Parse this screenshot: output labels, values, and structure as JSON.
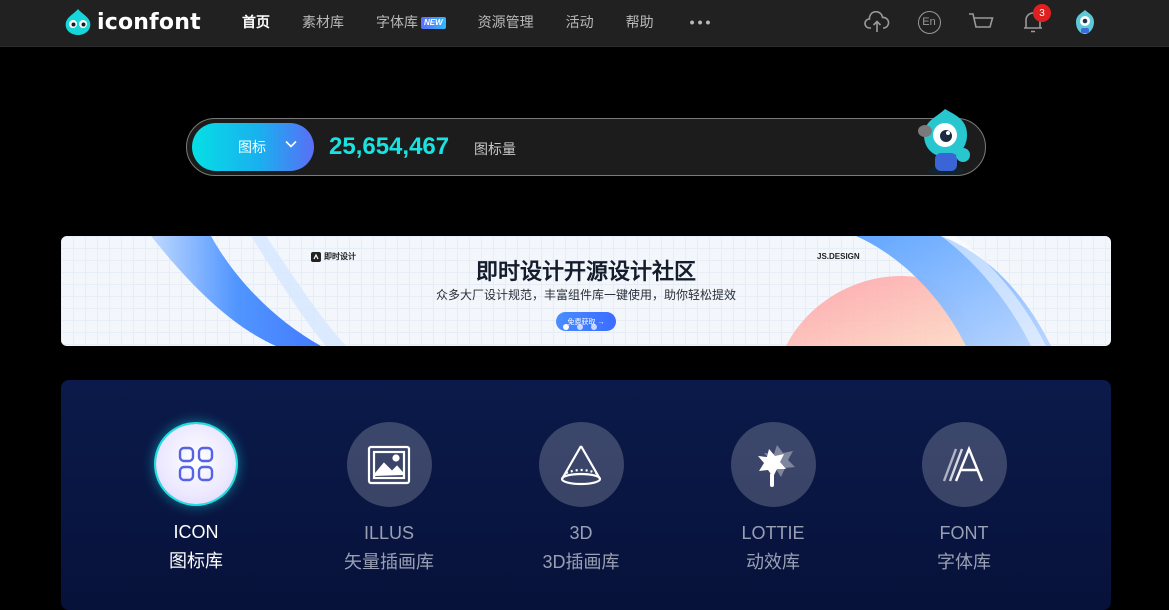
{
  "header": {
    "logo_text": "iconfont",
    "nav": [
      {
        "label": "首页",
        "active": true
      },
      {
        "label": "素材库",
        "active": false
      },
      {
        "label": "字体库",
        "active": false,
        "badge": "NEW"
      },
      {
        "label": "资源管理",
        "active": false
      },
      {
        "label": "活动",
        "active": false
      },
      {
        "label": "帮助",
        "active": false
      }
    ],
    "more": "•••",
    "lang_label": "En",
    "notification_count": "3"
  },
  "search": {
    "type_label": "图标",
    "count": "25,654,467",
    "count_label": "图标量"
  },
  "banner": {
    "brand_left": "即时设计",
    "brand_right": "JS.DESIGN",
    "title": "即时设计开源设计社区",
    "subtitle": "众多大厂设计规范，丰富组件库一键使用，助你轻松提效",
    "button": "免费获取 →"
  },
  "categories": [
    {
      "en": "ICON",
      "cn": "图标库",
      "icon": "icon-grid-icon",
      "active": true
    },
    {
      "en": "ILLUS",
      "cn": "矢量插画库",
      "icon": "image-icon",
      "active": false
    },
    {
      "en": "3D",
      "cn": "3D插画库",
      "icon": "cone-3d-icon",
      "active": false
    },
    {
      "en": "LOTTIE",
      "cn": "动效库",
      "icon": "lottie-icon",
      "active": false
    },
    {
      "en": "FONT",
      "cn": "字体库",
      "icon": "font-a-icon",
      "active": false
    }
  ],
  "colors": {
    "accent_cyan": "#18e3e0",
    "nav_bg": "#212121",
    "panel_bg": "#0b1a4a",
    "badge_red": "#e02020"
  }
}
